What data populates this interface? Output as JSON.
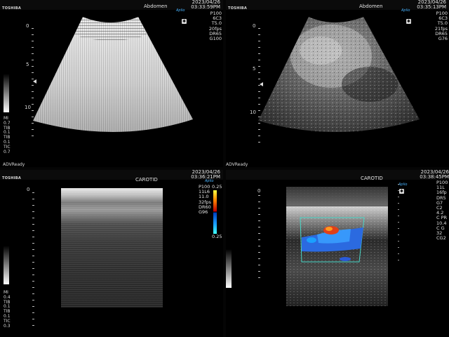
{
  "brand": "TOSHIBA",
  "logo_text": "Aplio",
  "panels": [
    {
      "preset": "Abdomen",
      "date": "2023/04/26",
      "time": "03:33:59PM",
      "params": [
        "P100",
        "6C3",
        "T5.0",
        "20fps",
        "DR65",
        "G100"
      ],
      "depth_marks": [
        "0",
        "5",
        "10"
      ],
      "mi_tis": [
        "MI",
        "0.7",
        "TIB",
        "0.1",
        "TIB",
        "0.1",
        "TIC",
        "0.7"
      ],
      "status": "ADVReady",
      "icon": "gear-icon"
    },
    {
      "preset": "Abdomen",
      "date": "2023/04/26",
      "time": "03:35:13PM",
      "params": [
        "P100",
        "6C3",
        "T5.0",
        "21fps",
        "DR65",
        "G76"
      ],
      "depth_marks": [
        "0",
        "5",
        "10"
      ],
      "status": "ADVReady",
      "icon": "gear-icon"
    },
    {
      "preset": "CAROTID",
      "date": "2023/04/26",
      "time": "03:36:21PM",
      "params": [
        "P100",
        "11L6",
        "11.0",
        "32fps",
        "DR60",
        "G96"
      ],
      "scale_top": "0.25",
      "scale_bottom": "0.25",
      "depth_marks": [
        "0"
      ],
      "mi_tis": [
        "MI",
        "0.4",
        "TIB",
        "0.1",
        "TIB",
        "0.1",
        "TIC",
        "0.3"
      ],
      "icon": "gear-icon"
    },
    {
      "preset": "CAROTID",
      "date": "2023/04/26",
      "time": "03:38:45PM",
      "params": [
        "P100",
        "11L",
        "16fp",
        "DR5",
        "G7",
        "C2",
        "4.2",
        "C PR",
        "10.4",
        "C G",
        "32",
        "CG2"
      ],
      "depth_marks": [
        "0"
      ],
      "icon": "gear-icon"
    }
  ]
}
